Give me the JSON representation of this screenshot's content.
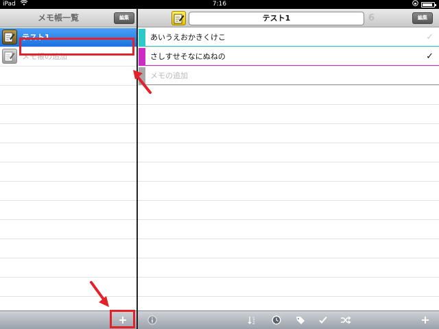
{
  "status_bar": {
    "device": "iPad",
    "time": "7:16",
    "battery_level": 0.85
  },
  "left_pane": {
    "title": "メモ帳一覧",
    "edit_label": "編集",
    "memos": [
      {
        "label": "テスト1",
        "selected": true
      }
    ],
    "add_placeholder": "メモ帳の追加",
    "add_button": "+"
  },
  "right_pane": {
    "memo_title": "テスト1",
    "count": "6",
    "edit_label": "編集",
    "items": [
      {
        "text": "あいうえおかきくけこ",
        "color": "#2ec8c8",
        "checked": false
      },
      {
        "text": "さしすせそなにぬねの",
        "color": "#cc2cc4",
        "checked": true
      }
    ],
    "add_placeholder": "メモの追加",
    "toolbar": {
      "add_button": "+"
    }
  },
  "colors": {
    "highlight": "#e3212a",
    "selected_row": "#1b72e0"
  }
}
